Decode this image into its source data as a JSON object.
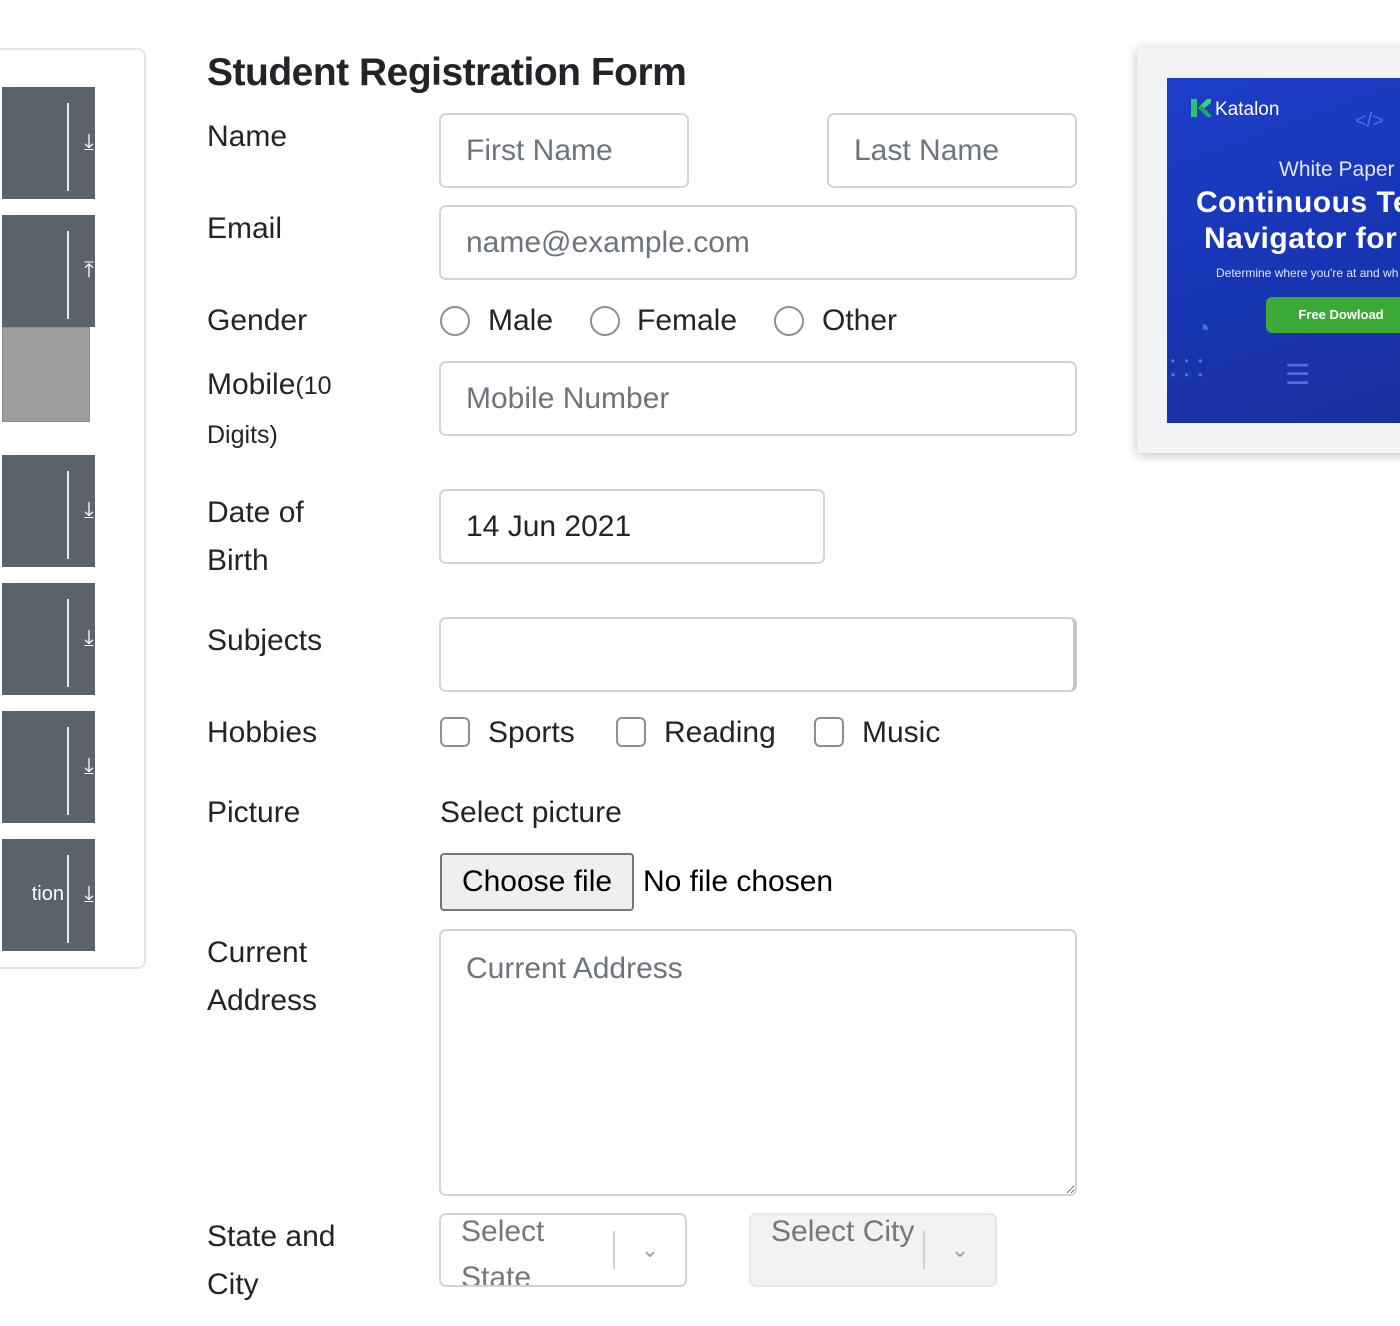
{
  "sidebar": {
    "buttons": [
      {
        "icon": "download-icon",
        "glyph": "⤓",
        "label": ""
      },
      {
        "icon": "upload-icon",
        "glyph": "⤒",
        "label": ""
      },
      {
        "icon": "download-icon",
        "glyph": "⤓",
        "label": ""
      },
      {
        "icon": "download-icon",
        "glyph": "⤓",
        "label": ""
      },
      {
        "icon": "download-icon",
        "glyph": "⤓",
        "label": ""
      },
      {
        "icon": "download-icon",
        "glyph": "⤓",
        "label": "tion"
      }
    ]
  },
  "form": {
    "title": "Student Registration Form",
    "name": {
      "label": "Name",
      "first_placeholder": "First Name",
      "last_placeholder": "Last Name"
    },
    "email": {
      "label": "Email",
      "placeholder": "name@example.com"
    },
    "gender": {
      "label": "Gender",
      "options": [
        "Male",
        "Female",
        "Other"
      ]
    },
    "mobile": {
      "label": "Mobile",
      "label_suffix": "(10",
      "label_line2": "Digits)",
      "placeholder": "Mobile Number"
    },
    "dob": {
      "label_line1": "Date of",
      "label_line2": "Birth",
      "value": "14 Jun 2021"
    },
    "subjects": {
      "label": "Subjects",
      "value": ""
    },
    "hobbies": {
      "label": "Hobbies",
      "options": [
        "Sports",
        "Reading",
        "Music"
      ]
    },
    "picture": {
      "label": "Picture",
      "caption": "Select picture",
      "button": "Choose file",
      "status": "No file chosen"
    },
    "address": {
      "label_line1": "Current",
      "label_line2": "Address",
      "placeholder": "Current Address"
    },
    "state_city": {
      "label_line1": "State and",
      "label_line2": "City",
      "state_placeholder": "Select State",
      "city_placeholder": "Select City",
      "chevron": "⌄"
    }
  },
  "ad": {
    "brand": "Katalon",
    "kicker": "White Paper",
    "headline_line1": "Continuous Te",
    "headline_line2": "Navigator for",
    "subline": "Determine where you're at and wh",
    "cta": "Free Dowload",
    "colors": {
      "background": "#1d3ec9",
      "cta": "#3aa935"
    }
  }
}
